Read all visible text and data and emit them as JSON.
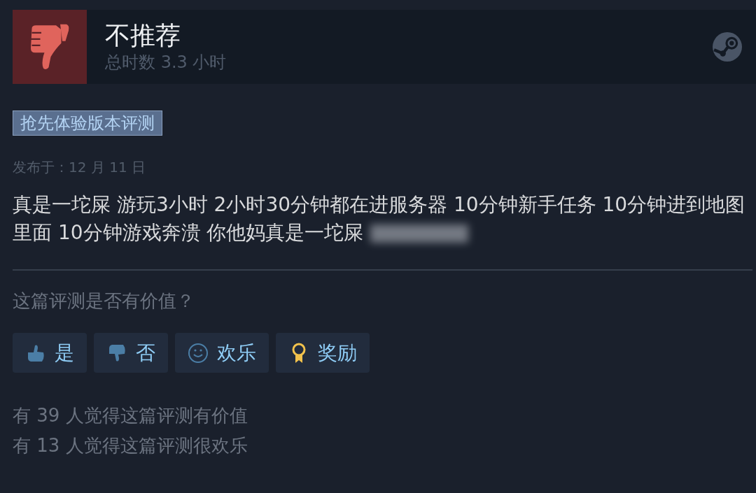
{
  "header": {
    "verdict": "不推荐",
    "recommended": false,
    "hours": "总时数 3.3 小时"
  },
  "tag": "抢先体验版本评测",
  "posted": "发布于：12 月 11 日",
  "review_text": "真是一坨屎 游玩3小时 2小时30分钟都在进服务器 10分钟新手任务 10分钟进到地图里面 10分钟游戏奔溃 你他妈真是一坨屎",
  "review_obscured": true,
  "question": "这篇评测是否有价值？",
  "buttons": [
    {
      "kind": "thumb-up",
      "label": "是"
    },
    {
      "kind": "thumb-down",
      "label": "否"
    },
    {
      "kind": "smile",
      "label": "欢乐"
    },
    {
      "kind": "award",
      "label": "奖励"
    }
  ],
  "counts": [
    "有 39 人觉得这篇评测有价值",
    "有 13 人觉得这篇评测很欢乐"
  ]
}
